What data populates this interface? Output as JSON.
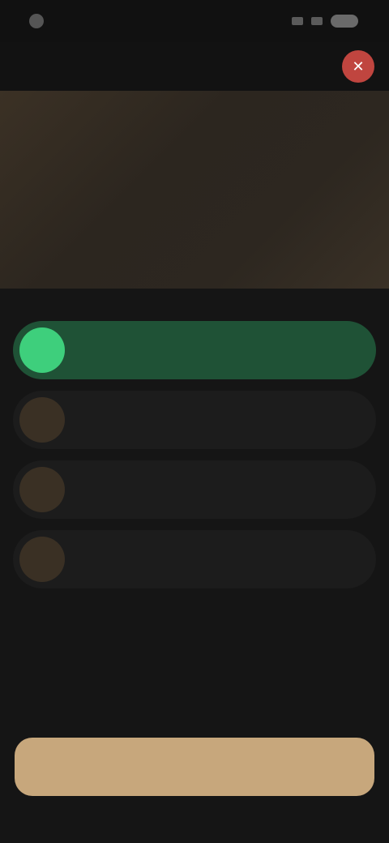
{
  "status_bar": {
    "time": "",
    "battery": ""
  },
  "header": {
    "title": "",
    "close_label": "✕"
  },
  "question": {
    "text": ""
  },
  "options": [
    {
      "badge": "",
      "label": "",
      "selected": true
    },
    {
      "badge": "",
      "label": "",
      "selected": false
    },
    {
      "badge": "",
      "label": "",
      "selected": false
    },
    {
      "badge": "",
      "label": "",
      "selected": false
    }
  ],
  "footer": {
    "continue_label": ""
  },
  "colors": {
    "selected": "#1f5236",
    "selected_badge": "#3ecf7c",
    "close": "#c0453f",
    "primary_button": "#c7a77c"
  }
}
